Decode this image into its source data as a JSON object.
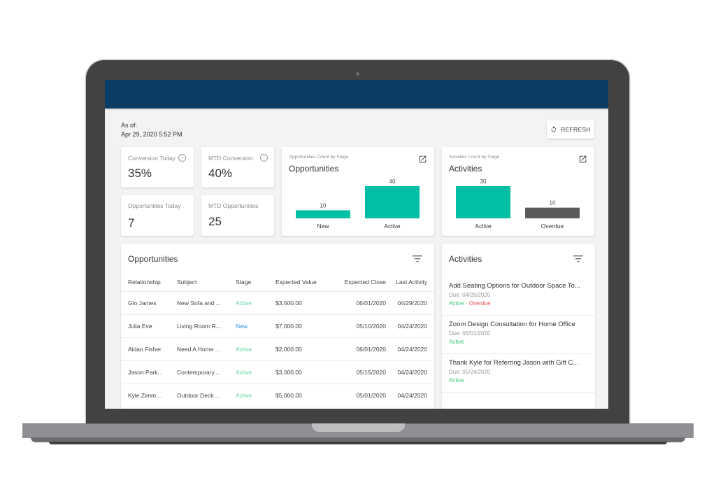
{
  "header": {
    "asof_label": "As of:",
    "asof_value": "Apr 29, 2020 5:52 PM",
    "refresh_label": "REFRESH"
  },
  "kpis": [
    {
      "label": "Conversion Today",
      "value": "35%",
      "info": true
    },
    {
      "label": "MTD Conversion",
      "value": "40%",
      "info": true
    },
    {
      "label": "Opportunities Today",
      "value": "7",
      "info": false
    },
    {
      "label": "MTD Opportunities",
      "value": "25",
      "info": false
    }
  ],
  "colors": {
    "brand": "#0b3c64",
    "bar_primary": "#00bfa5",
    "bar_secondary": "#5a5a5a",
    "status_active": "#3cc47a",
    "status_overdue": "#e8464b",
    "status_new": "#2f8fe0"
  },
  "chart_data": [
    {
      "type": "bar",
      "subtitle": "Opportunities Count by Stage",
      "title": "Opportunities",
      "categories": [
        "New",
        "Active"
      ],
      "values": [
        10,
        40
      ],
      "colors": [
        "#00bfa5",
        "#00bfa5"
      ],
      "ylim": [
        0,
        40
      ],
      "grid": false
    },
    {
      "type": "bar",
      "subtitle": "Activities Count by Stage",
      "title": "Activities",
      "categories": [
        "Active",
        "Overdue"
      ],
      "values": [
        30,
        10
      ],
      "colors": [
        "#00bfa5",
        "#5a5a5a"
      ],
      "ylim": [
        0,
        30
      ],
      "grid": false
    }
  ],
  "opportunities": {
    "title": "Opportunities",
    "columns": [
      "Relationship",
      "Subject",
      "Stage",
      "Expected Value",
      "Expected Close",
      "Last Activity"
    ],
    "rows": [
      {
        "relationship": "Gio James",
        "subject": "New Sofa and ...",
        "stage": "Active",
        "value": "$3,500.00",
        "close": "06/01/2020",
        "last": "04/29/2020"
      },
      {
        "relationship": "Julia Eve",
        "subject": "Living Room R...",
        "stage": "New",
        "value": "$7,000.00",
        "close": "05/10/2020",
        "last": "04/24/2020"
      },
      {
        "relationship": "Aidan Fisher",
        "subject": "Need A Home ...",
        "stage": "Active",
        "value": "$2,000.00",
        "close": "06/01/2020",
        "last": "04/24/2020"
      },
      {
        "relationship": "Jason Park...",
        "subject": "Contemporary...",
        "stage": "Active",
        "value": "$3,000.00",
        "close": "05/15/2020",
        "last": "04/24/2020"
      },
      {
        "relationship": "Kyle Zimm...",
        "subject": "Outdoor Deck ...",
        "stage": "Active",
        "value": "$5,000.00",
        "close": "05/01/2020",
        "last": "04/24/2020"
      }
    ]
  },
  "activities": {
    "title": "Activities",
    "items": [
      {
        "title": "Add Seating Options for Outdoor Space To...",
        "due": "Due: 04/28/2020",
        "status": "Active",
        "separator": " - ",
        "overdue": "Overdue"
      },
      {
        "title": "Zoom Design Consultation for Home Office",
        "due": "Due: 05/01/2020",
        "status": "Active",
        "separator": "",
        "overdue": ""
      },
      {
        "title": "Thank Kyle for Referring Jason with Gift C...",
        "due": "Due: 05/24/2020",
        "status": "Active",
        "separator": "",
        "overdue": ""
      }
    ]
  }
}
